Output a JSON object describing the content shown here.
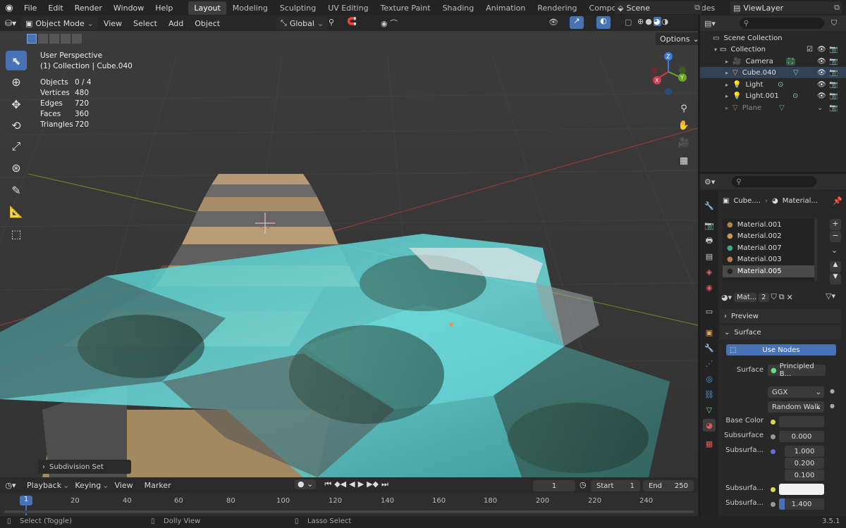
{
  "menu": {
    "file": "File",
    "edit": "Edit",
    "render": "Render",
    "window": "Window",
    "help": "Help"
  },
  "workspaces": [
    "Layout",
    "Modeling",
    "Sculpting",
    "UV Editing",
    "Texture Paint",
    "Shading",
    "Animation",
    "Rendering",
    "Compositing",
    "Geometry Nodes"
  ],
  "scene": {
    "name": "Scene",
    "view_layer": "ViewLayer"
  },
  "viewport": {
    "mode": "Object Mode",
    "view": "View",
    "select": "Select",
    "add": "Add",
    "object": "Object",
    "orientation": "Global",
    "options": "Options",
    "perspective": "User Perspective",
    "collection_info": "(1) Collection | Cube.040",
    "stats": [
      {
        "label": "Objects",
        "value": "0 / 4"
      },
      {
        "label": "Vertices",
        "value": "480"
      },
      {
        "label": "Edges",
        "value": "720"
      },
      {
        "label": "Faces",
        "value": "360"
      },
      {
        "label": "Triangles",
        "value": "720"
      }
    ],
    "operator_panel": "Subdivision Set",
    "gizmo": {
      "x": "X",
      "y": "Y",
      "z": "Z"
    }
  },
  "outliner": {
    "root": "Scene Collection",
    "collection": "Collection",
    "items": [
      {
        "name": "Camera"
      },
      {
        "name": "Cube.040"
      },
      {
        "name": "Light"
      },
      {
        "name": "Light.001"
      },
      {
        "name": "Plane"
      }
    ]
  },
  "properties": {
    "breadcrumb_obj": "Cube....",
    "breadcrumb_mat": "Material...",
    "materials": [
      "Material.001",
      "Material.002",
      "Material.007",
      "Material.003",
      "Material.005"
    ],
    "mat_name": "Mat...",
    "users": "2",
    "preview": "Preview",
    "surface_panel": "Surface",
    "use_nodes": "Use Nodes",
    "surface_label": "Surface",
    "surface_value": "Principled B...",
    "distribution": "GGX",
    "subsurface_method": "Random Walk",
    "base_color_label": "Base Color",
    "subsurface_label": "Subsurface",
    "subsurface_value": "0.000",
    "subsurface_radius_label": "Subsurfa...",
    "radius": [
      "1.000",
      "0.200",
      "0.100"
    ],
    "subsurface_color_label": "Subsurfa...",
    "subsurface_ior_label": "Subsurfa...",
    "subsurface_ior": "1.400"
  },
  "timeline": {
    "playback": "Playback",
    "keying": "Keying",
    "view": "View",
    "marker": "Marker",
    "current_frame": "1",
    "start_label": "Start",
    "start": "1",
    "end_label": "End",
    "end": "250",
    "ticks": [
      "1",
      "20",
      "40",
      "60",
      "80",
      "100",
      "120",
      "140",
      "160",
      "180",
      "200",
      "220",
      "240"
    ]
  },
  "status": {
    "select": "Select (Toggle)",
    "dolly": "Dolly View",
    "lasso": "Lasso Select",
    "version": "3.5.1"
  },
  "colors": {
    "accent": "#4772b3",
    "bg": "#1d1d1d",
    "panel": "#282828",
    "water": "#5fd4d4"
  }
}
